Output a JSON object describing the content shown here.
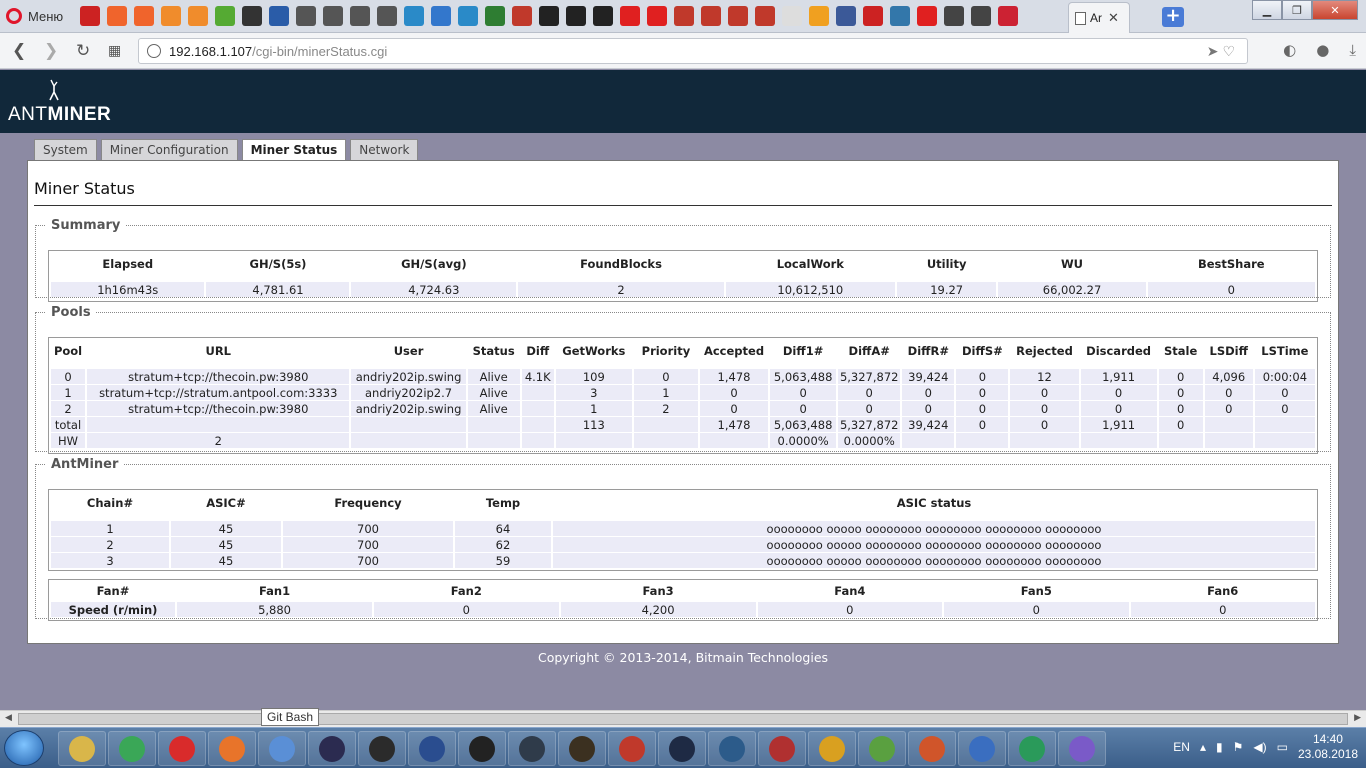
{
  "browser": {
    "menu_label": "Меню",
    "active_tab_label": "Ar",
    "url_host": "192.168.1.107",
    "url_path": "/cgi-bin/minerStatus.cgi"
  },
  "header": {
    "logo_ant": "ANT",
    "logo_miner": "MINER"
  },
  "nav_tabs": [
    {
      "label": "System"
    },
    {
      "label": "Miner Configuration"
    },
    {
      "label": "Miner Status"
    },
    {
      "label": "Network"
    }
  ],
  "page_title": "Miner Status",
  "summary": {
    "legend": "Summary",
    "headers": [
      "Elapsed",
      "GH/S(5s)",
      "GH/S(avg)",
      "FoundBlocks",
      "LocalWork",
      "Utility",
      "WU",
      "BestShare"
    ],
    "values": [
      "1h16m43s",
      "4,781.61",
      "4,724.63",
      "2",
      "10,612,510",
      "19.27",
      "66,002.27",
      "0"
    ]
  },
  "pools": {
    "legend": "Pools",
    "headers": [
      "Pool",
      "URL",
      "User",
      "Status",
      "Diff",
      "GetWorks",
      "Priority",
      "Accepted",
      "Diff1#",
      "DiffA#",
      "DiffR#",
      "DiffS#",
      "Rejected",
      "Discarded",
      "Stale",
      "LSDiff",
      "LSTime"
    ],
    "rows": [
      [
        "0",
        "stratum+tcp://thecoin.pw:3980",
        "andriy202ip.swing",
        "Alive",
        "4.1K",
        "109",
        "0",
        "1,478",
        "5,063,488",
        "5,327,872",
        "39,424",
        "0",
        "12",
        "1,911",
        "0",
        "4,096",
        "0:00:04"
      ],
      [
        "1",
        "stratum+tcp://stratum.antpool.com:3333",
        "andriy202ip2.7",
        "Alive",
        "",
        "3",
        "1",
        "0",
        "0",
        "0",
        "0",
        "0",
        "0",
        "0",
        "0",
        "0",
        "0"
      ],
      [
        "2",
        "stratum+tcp://thecoin.pw:3980",
        "andriy202ip.swing",
        "Alive",
        "",
        "1",
        "2",
        "0",
        "0",
        "0",
        "0",
        "0",
        "0",
        "0",
        "0",
        "0",
        "0"
      ],
      [
        "total",
        "",
        "",
        "",
        "",
        "113",
        "",
        "1,478",
        "5,063,488",
        "5,327,872",
        "39,424",
        "0",
        "0",
        "1,911",
        "0",
        "",
        ""
      ],
      [
        "HW",
        "2",
        "",
        "",
        "",
        "",
        "",
        "",
        "0.0000%",
        "0.0000%",
        "",
        "",
        "",
        "",
        "",
        "",
        ""
      ]
    ]
  },
  "antminer": {
    "legend": "AntMiner",
    "chain_headers": [
      "Chain#",
      "ASIC#",
      "Frequency",
      "Temp",
      "ASIC status"
    ],
    "chains": [
      [
        "1",
        "45",
        "700",
        "64",
        "oooooooo ooooo oooooooo oooooooo oooooooo oooooooo"
      ],
      [
        "2",
        "45",
        "700",
        "62",
        "oooooooo ooooo oooooooo oooooooo oooooooo oooooooo"
      ],
      [
        "3",
        "45",
        "700",
        "59",
        "oooooooo ooooo oooooooo oooooooo oooooooo oooooooo"
      ]
    ],
    "fan_headers": [
      "Fan#",
      "Fan1",
      "Fan2",
      "Fan3",
      "Fan4",
      "Fan5",
      "Fan6"
    ],
    "fan_speed_label": "Speed (r/min)",
    "fan_speeds": [
      "5,880",
      "0",
      "4,200",
      "0",
      "0",
      "0"
    ]
  },
  "footer": "Copyright © 2013-2014, Bitmain Technologies",
  "tooltip": "Git Bash",
  "tray": {
    "lang": "EN",
    "time": "14:40",
    "date": "23.08.2018"
  },
  "colors": {
    "header_bg": "#11283a",
    "page_bg": "#8c8aa3",
    "cell_bg": "#ebebf7"
  }
}
